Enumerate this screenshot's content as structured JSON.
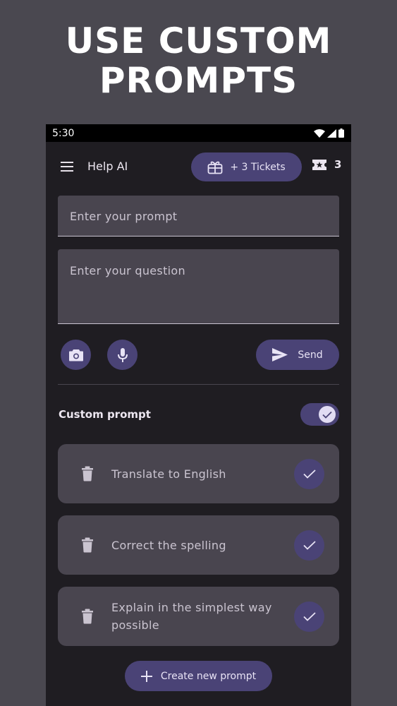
{
  "headline": {
    "line1": "USE CUSTOM",
    "line2": "PROMPTS"
  },
  "status_bar": {
    "time": "5:30"
  },
  "app_bar": {
    "title": "Help AI",
    "tickets_button_label": "+ 3 Tickets",
    "ticket_count": "3"
  },
  "inputs": {
    "prompt_placeholder": "Enter your prompt",
    "question_placeholder": "Enter your question"
  },
  "actions": {
    "send_label": "Send"
  },
  "custom_prompt": {
    "label": "Custom prompt",
    "enabled": true,
    "items": [
      {
        "text": "Translate to English",
        "selected": true
      },
      {
        "text": "Correct the spelling",
        "selected": true
      },
      {
        "text": "Explain in the simplest way possible",
        "selected": true
      }
    ],
    "create_label": "Create new prompt"
  },
  "colors": {
    "outer_background": "#4a4850",
    "app_background": "#1f1d22",
    "surface": "#49454f",
    "accent_container": "#4a4376",
    "on_accent": "#e8e3f5"
  }
}
